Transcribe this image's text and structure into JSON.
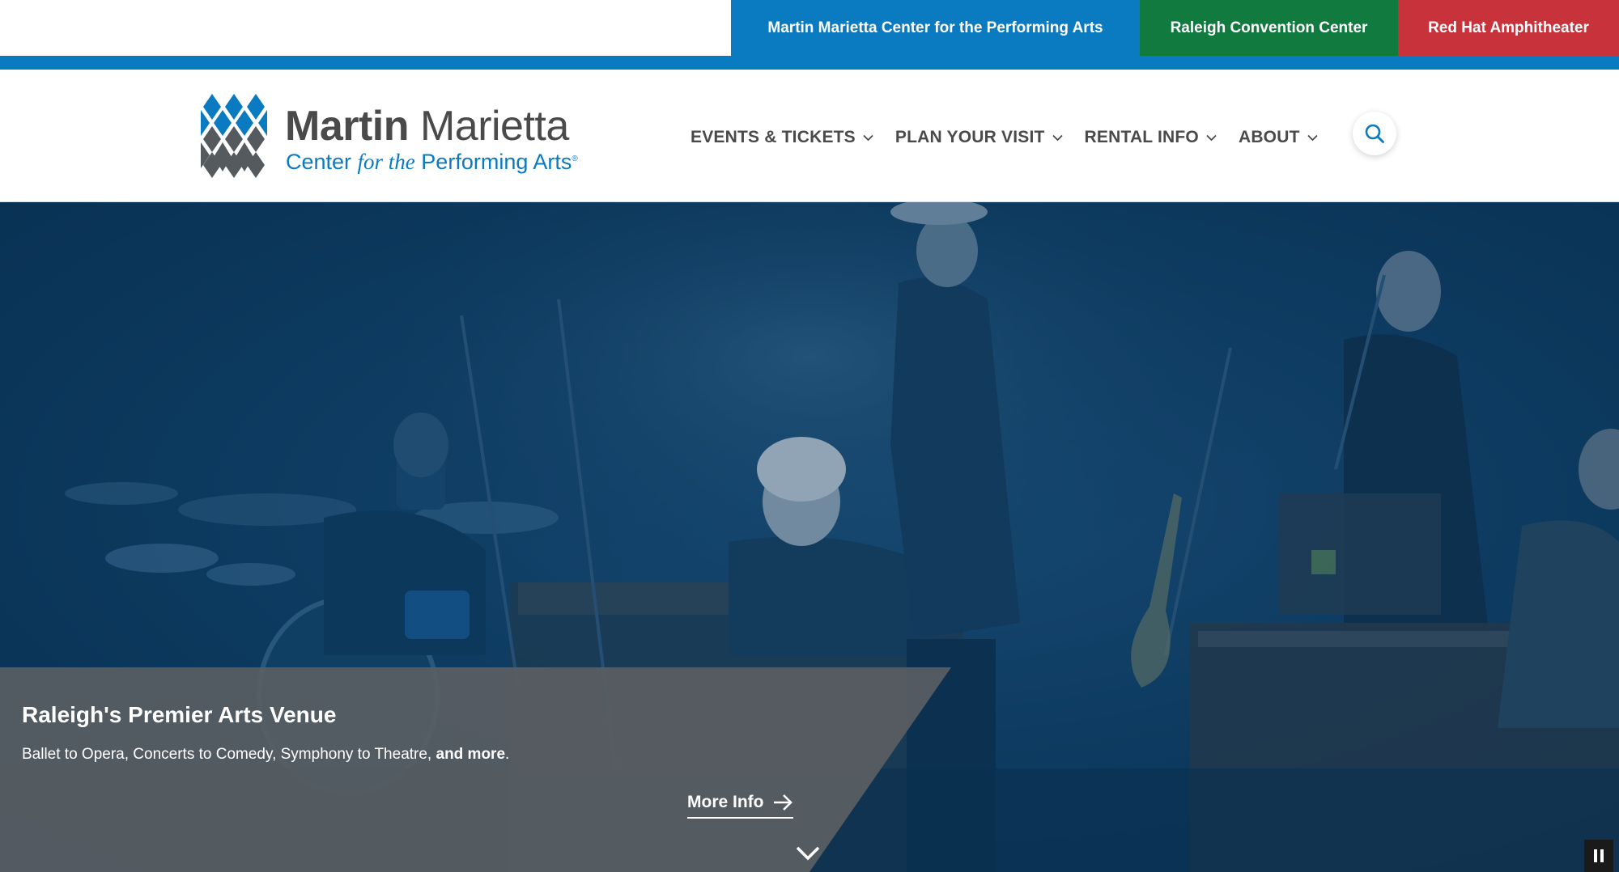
{
  "colors": {
    "primary_blue": "#0a7bc0",
    "convention_green": "#117a3f",
    "amphitheater_red": "#c8323a",
    "nav_text": "#4a4a4a",
    "caption_panel": "#5a5e63"
  },
  "venue_bar": {
    "links": [
      {
        "label": "Martin Marietta Center for the Performing Arts",
        "color": "#0a7bc0"
      },
      {
        "label": "Raleigh Convention Center",
        "color": "#117a3f"
      },
      {
        "label": "Red Hat Amphitheater",
        "color": "#c8323a"
      }
    ]
  },
  "logo": {
    "title_bold": "Martin",
    "title_light": "Marietta",
    "sub_a": "Center ",
    "sub_italic": "for the",
    "sub_b": " Performing Arts",
    "sub_mark": "®"
  },
  "nav": {
    "items": [
      {
        "label": "EVENTS & TICKETS",
        "icon": "chevron-down-icon"
      },
      {
        "label": "PLAN YOUR VISIT",
        "icon": "chevron-down-icon"
      },
      {
        "label": "RENTAL INFO",
        "icon": "chevron-down-icon"
      },
      {
        "label": "ABOUT",
        "icon": "chevron-down-icon"
      }
    ],
    "search_icon": "search-icon"
  },
  "hero": {
    "title": "Raleigh's Premier Arts Venue",
    "text": "Ballet to Opera, Concerts to Comedy, Symphony to Theatre, ",
    "text_bold": "and more",
    "text_end": ".",
    "cta_label": "More Info",
    "cta_icon": "arrow-right-icon",
    "scroll_icon": "chevron-down-icon",
    "pause_icon": "pause-icon"
  }
}
